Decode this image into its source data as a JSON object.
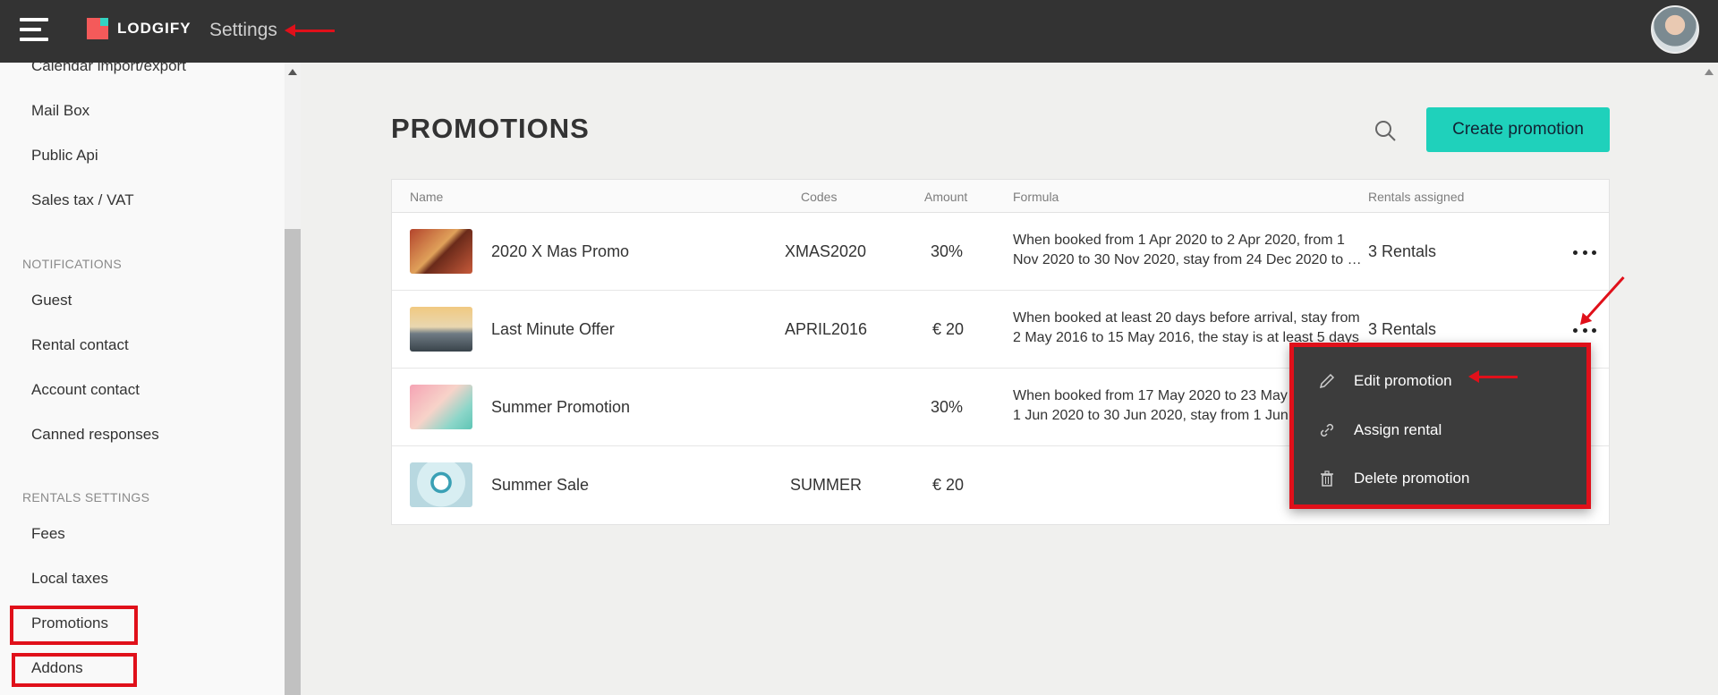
{
  "topbar": {
    "brand": "LODGIFY",
    "section_title": "Settings"
  },
  "sidebar": {
    "items_top": [
      "Calendar import/export",
      "Mail Box",
      "Public Api",
      "Sales tax / VAT"
    ],
    "notifications_heading": "NOTIFICATIONS",
    "notifications_items": [
      "Guest",
      "Rental contact",
      "Account contact",
      "Canned responses"
    ],
    "rentals_heading": "RENTALS SETTINGS",
    "rentals_items": [
      "Fees",
      "Local taxes",
      "Promotions",
      "Addons"
    ]
  },
  "main": {
    "title": "PROMOTIONS",
    "create_button": "Create  promotion",
    "columns": [
      "Name",
      "Codes",
      "Amount",
      "Formula",
      "Rentals assigned"
    ],
    "rows": [
      {
        "name": "2020 X Mas Promo",
        "code": "XMAS2020",
        "amount": "30%",
        "formula_line1": "When booked from 1 Apr 2020 to 2 Apr 2020, from 1",
        "formula_line2": "Nov 2020 to 30 Nov 2020, stay from 24 Dec 2020 to 3…",
        "rentals": "3 Rentals"
      },
      {
        "name": "Last Minute Offer",
        "code": "APRIL2016",
        "amount": "€ 20",
        "formula_line1": "When booked at least 20 days before arrival, stay from",
        "formula_line2": "2 May 2016 to 15 May 2016, the stay is at least 5 days",
        "rentals": "3 Rentals"
      },
      {
        "name": "Summer Promotion",
        "code": "",
        "amount": "30%",
        "formula_line1": "When booked from 17 May 2020 to 23 May 2020, from",
        "formula_line2": "1 Jun 2020 to 30 Jun 2020, stay from 1 Jun 2020",
        "rentals": ""
      },
      {
        "name": "Summer Sale",
        "code": "SUMMER",
        "amount": "€ 20",
        "formula_line1": "",
        "formula_line2": "",
        "rentals": ""
      }
    ]
  },
  "context_menu": {
    "items": [
      "Edit promotion",
      "Assign rental",
      "Delete promotion"
    ]
  },
  "colors": {
    "topbar": "#333333",
    "accent": "#1fd1bb",
    "annotation_red": "#e0101a",
    "menu_bg": "#3c3c3c"
  },
  "icons": [
    "hamburger-icon",
    "search-icon",
    "more-dots-icon",
    "pencil-icon",
    "link-icon",
    "trash-icon"
  ]
}
